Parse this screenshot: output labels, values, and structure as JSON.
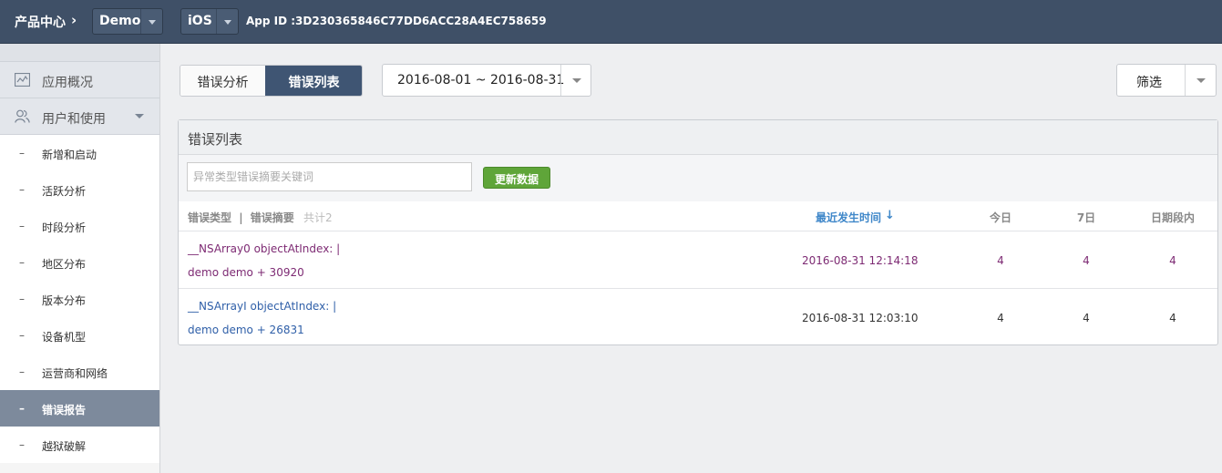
{
  "topbar": {
    "product": "产品中心",
    "app": "Demo",
    "platform": "iOS",
    "app_id": "App ID :3D230365846C77DD6ACC28A4EC758659"
  },
  "sidebar": {
    "overview": "应用概况",
    "users_usage": "用户和使用",
    "items": [
      {
        "label": "新增和启动",
        "active": false
      },
      {
        "label": "活跃分析",
        "active": false
      },
      {
        "label": "时段分析",
        "active": false
      },
      {
        "label": "地区分布",
        "active": false
      },
      {
        "label": "版本分布",
        "active": false
      },
      {
        "label": "设备机型",
        "active": false
      },
      {
        "label": "运营商和网络",
        "active": false
      },
      {
        "label": "错误报告",
        "active": true
      },
      {
        "label": "越狱破解",
        "active": false
      }
    ]
  },
  "tabs": {
    "analysis": "错误分析",
    "list": "错误列表"
  },
  "date_range": "2016-08-01 ~ 2016-08-31",
  "filter": "筛选",
  "panel": {
    "title": "错误列表",
    "search_placeholder": "异常类型错误摘要关键词",
    "refresh": "更新数据"
  },
  "table": {
    "col_type": "错误类型",
    "separator": "|",
    "col_summary": "错误摘要",
    "count": "共计2",
    "col_last_time": "最近发生时间",
    "sort_arrow": "↓",
    "col_today": "今日",
    "col_7d": "7日",
    "col_range": "日期段内",
    "rows": [
      {
        "type": "__NSArray0 objectAtIndex: |",
        "summary": "demo demo + 30920",
        "time": "2016-08-31 12:14:18",
        "today": "4",
        "d7": "4",
        "range": "4"
      },
      {
        "type": "__NSArrayI objectAtIndex: |",
        "summary": "demo demo + 26831",
        "time": "2016-08-31 12:03:10",
        "today": "4",
        "d7": "4",
        "range": "4"
      }
    ]
  },
  "colors": {
    "topbar": "#3f5067",
    "active_tab": "#3f5573",
    "refresh_button": "#5fa539",
    "row1_text": "#7d2a73",
    "row2_text": "#2f5fa8",
    "sort_link": "#3f87c9"
  }
}
